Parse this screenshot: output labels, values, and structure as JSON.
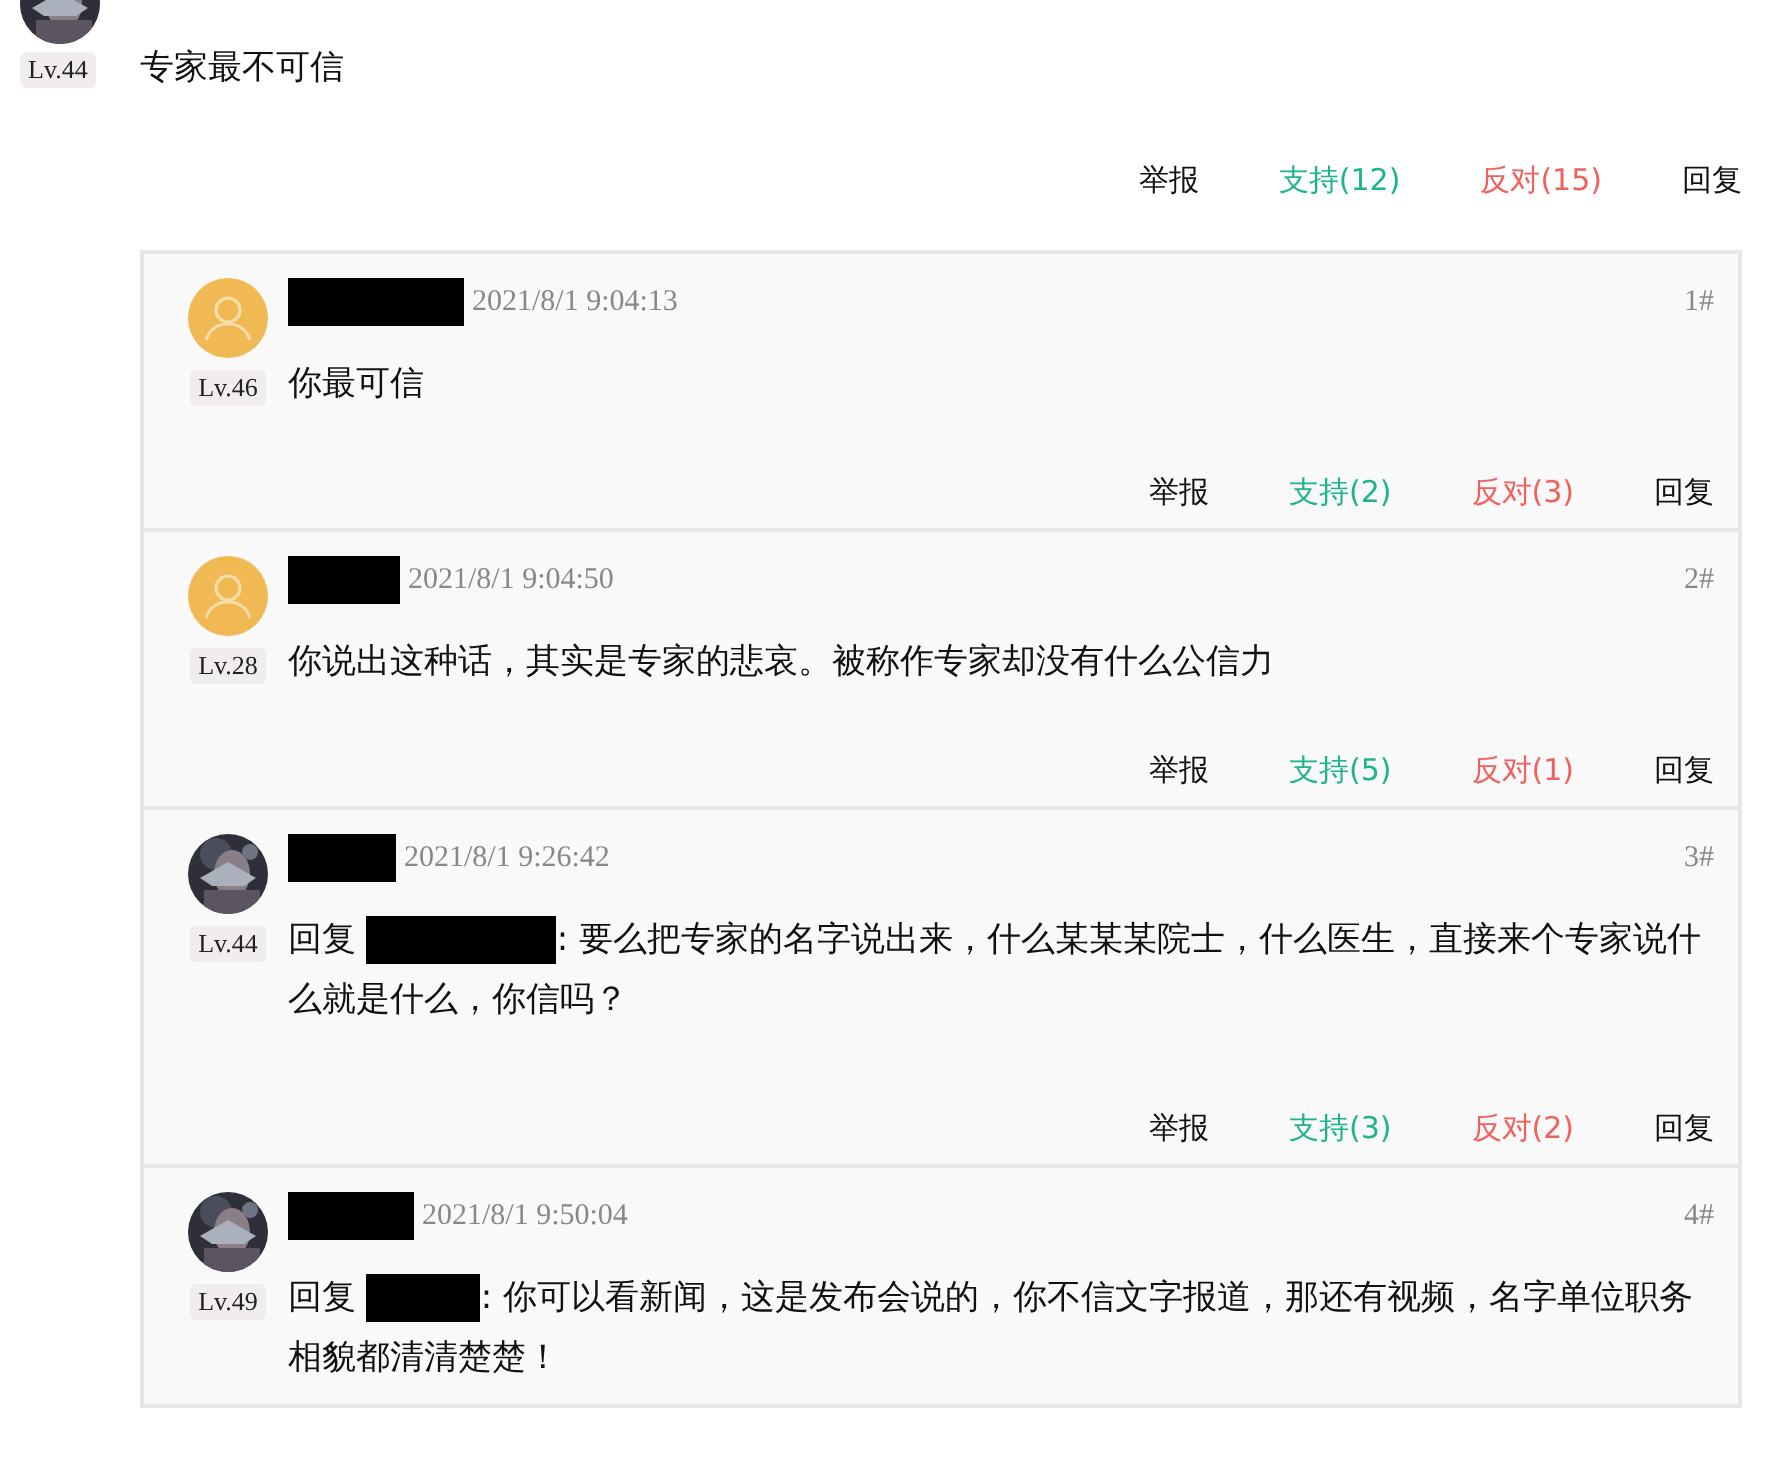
{
  "post": {
    "level": "Lv.44",
    "content": "专家最不可信",
    "actions": {
      "report": "举报",
      "support": "支持(12)",
      "oppose": "反对(15)",
      "reply": "回复"
    }
  },
  "replies": [
    {
      "avatar": {
        "kind": "default"
      },
      "level": "Lv.46",
      "time": "2021/8/1 9:04:13",
      "floor": "1#",
      "content": {
        "text": "你最可信"
      },
      "actions": {
        "report": "举报",
        "support": "支持(2)",
        "oppose": "反对(3)",
        "reply": "回复"
      }
    },
    {
      "avatar": {
        "kind": "default"
      },
      "level": "Lv.28",
      "time": "2021/8/1 9:04:50",
      "floor": "2#",
      "content": {
        "text": "你说出这种话，其实是专家的悲哀。被称作专家却没有什么公信力"
      },
      "actions": {
        "report": "举报",
        "support": "支持(5)",
        "oppose": "反对(1)",
        "reply": "回复"
      }
    },
    {
      "level": "Lv.44",
      "time": "2021/8/1 9:26:42",
      "floor": "3#",
      "content": {
        "prefix": "回复",
        "text": ": 要么把专家的名字说出来，什么某某某院士，什么医生，直接来个专家说什么就是什么，你信吗？"
      },
      "actions": {
        "report": "举报",
        "support": "支持(3)",
        "oppose": "反对(2)",
        "reply": "回复"
      }
    },
    {
      "level": "Lv.49",
      "time": "2021/8/1 9:50:04",
      "floor": "4#",
      "content": {
        "prefix": "回复",
        "text": ": 你可以看新闻，这是发布会说的，你不信文字报道，那还有视频，名字单位职务相貌都清清楚楚！"
      }
    }
  ]
}
